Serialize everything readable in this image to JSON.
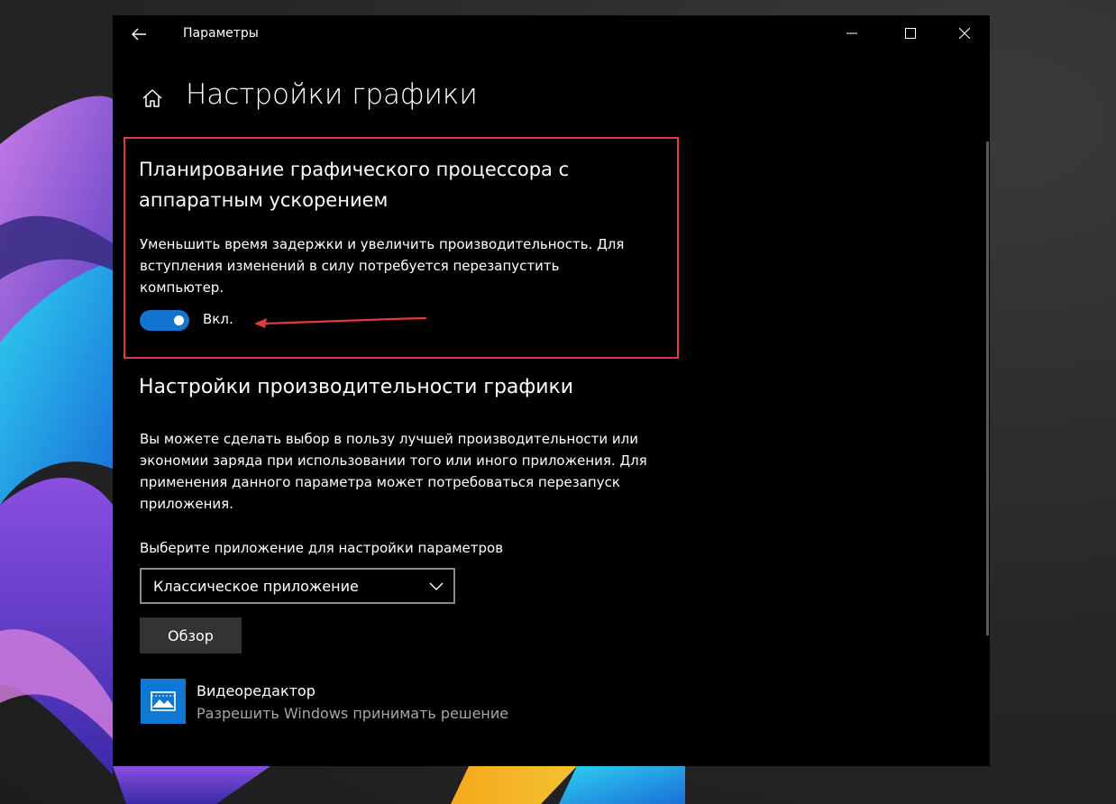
{
  "window": {
    "title": "Параметры"
  },
  "page": {
    "title": "Настройки графики"
  },
  "gpu_scheduling": {
    "title": "Планирование графического процессора с аппаратным ускорением",
    "description": "Уменьшить время задержки и увеличить производительность. Для вступления изменений в силу потребуется перезапустить компьютер.",
    "toggle_state_label": "Вкл.",
    "enabled": true
  },
  "graphics_performance": {
    "title": "Настройки производительности графики",
    "description": "Вы можете сделать выбор в пользу лучшей производительности или экономии заряда при использовании того или иного приложения. Для применения данного параметра может потребоваться перезапуск приложения.",
    "select_label": "Выберите приложение для настройки параметров",
    "select_value": "Классическое приложение",
    "browse_label": "Обзор"
  },
  "apps": [
    {
      "name": "Видеоредактор",
      "status": "Разрешить Windows принимать решение",
      "icon": "photos-video-icon"
    }
  ],
  "colors": {
    "accent": "#1475d1",
    "app_icon_bg": "#0f78d4",
    "highlight": "#e0393e",
    "window_bg": "#000000"
  }
}
